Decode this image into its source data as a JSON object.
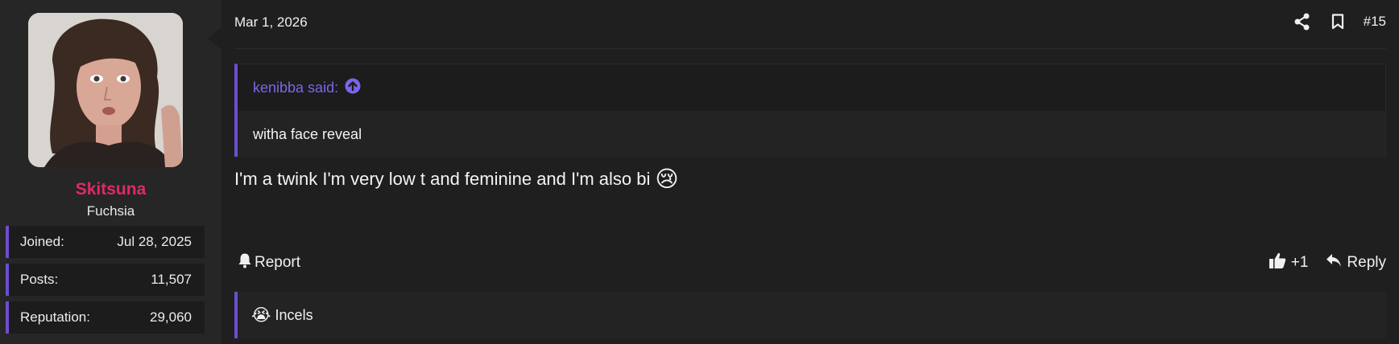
{
  "user": {
    "name": "Skitsuna",
    "title": "Fuchsia",
    "stats": [
      {
        "label": "Joined:",
        "value": "Jul 28, 2025"
      },
      {
        "label": "Posts:",
        "value": "11,507"
      },
      {
        "label": "Reputation:",
        "value": "29,060"
      }
    ]
  },
  "post": {
    "date": "Mar 1, 2026",
    "number": "#15",
    "quote": {
      "author_line": "kenibba said:",
      "text": "witha face reveal"
    },
    "message": "I'm a twink I'm very low t and feminine and I'm also bi",
    "message_emoji": "😢",
    "actions": {
      "report": "Report",
      "like_count": "+1",
      "reply": "Reply"
    },
    "reaction_bar": {
      "emoji": "😭",
      "label": "Incels"
    }
  },
  "colors": {
    "accent": "#6a4fd0",
    "username": "#e0286a",
    "quote_link": "#7a66e8",
    "background": "#1f1f1f"
  }
}
